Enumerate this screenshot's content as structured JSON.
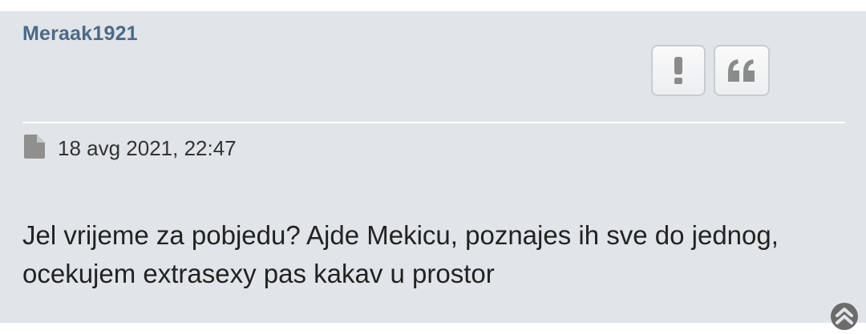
{
  "post": {
    "author": "Meraak1921",
    "timestamp": "18 avg 2021, 22:47",
    "body": "Jel vrijeme za pobjedu? Ajde Mekicu, poznajes ih sve do jednog, ocekujem extrasexy pas kakav u prostor",
    "actions": {
      "report_icon": "exclamation-icon",
      "quote_icon": "quote-icon"
    },
    "post_icon": "file-icon",
    "top_link_icon": "chevron-up-circle-icon"
  },
  "colors": {
    "post_background": "#e1e4e8",
    "author_link": "#4c6a86",
    "button_icon": "#8b8b8b",
    "meta_icon": "#8f8f8f",
    "top_link": "#6b6b6b"
  }
}
